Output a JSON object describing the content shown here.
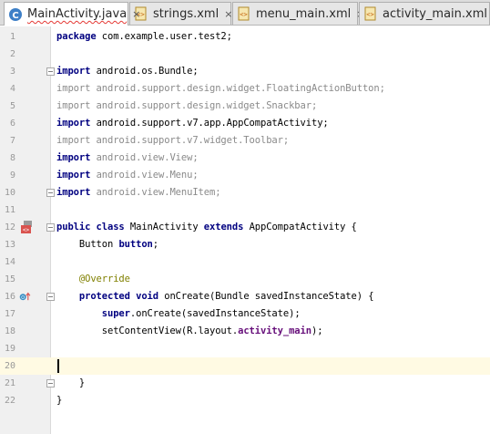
{
  "tabs": [
    {
      "label": "MainActivity.java",
      "icon": "java-class-icon",
      "active": true
    },
    {
      "label": "strings.xml",
      "icon": "xml-file-icon",
      "active": false
    },
    {
      "label": "menu_main.xml",
      "icon": "xml-file-icon",
      "active": false
    },
    {
      "label": "activity_main.xml",
      "icon": "xml-file-icon",
      "active": false
    }
  ],
  "close_glyph": "×",
  "editor": {
    "current_line": 20,
    "lines": [
      {
        "n": "1",
        "tokens": [
          [
            "kw",
            "package"
          ],
          [
            "plain",
            " com.example.user.test2;"
          ]
        ]
      },
      {
        "n": "2",
        "tokens": []
      },
      {
        "n": "3",
        "tokens": [
          [
            "kw",
            "import"
          ],
          [
            "plain",
            " android.os.Bundle;"
          ]
        ]
      },
      {
        "n": "4",
        "tokens": [
          [
            "dim",
            "import android.support.design.widget.FloatingActionButton;"
          ]
        ]
      },
      {
        "n": "5",
        "tokens": [
          [
            "dim",
            "import android.support.design.widget.Snackbar;"
          ]
        ]
      },
      {
        "n": "6",
        "tokens": [
          [
            "kw",
            "import"
          ],
          [
            "plain",
            " android.support.v7.app.AppCompatActivity;"
          ]
        ]
      },
      {
        "n": "7",
        "tokens": [
          [
            "dim",
            "import android.support.v7.widget.Toolbar;"
          ]
        ]
      },
      {
        "n": "8",
        "tokens": [
          [
            "kw",
            "import"
          ],
          [
            "dim",
            " android.view.View;"
          ]
        ]
      },
      {
        "n": "9",
        "tokens": [
          [
            "kw",
            "import"
          ],
          [
            "dim",
            " android.view.Menu;"
          ]
        ]
      },
      {
        "n": "10",
        "tokens": [
          [
            "kw",
            "import"
          ],
          [
            "dim",
            " android.view.MenuItem;"
          ]
        ]
      },
      {
        "n": "11",
        "tokens": []
      },
      {
        "n": "12",
        "tokens": [
          [
            "kw",
            "public class"
          ],
          [
            "plain",
            " MainActivity "
          ],
          [
            "kw",
            "extends"
          ],
          [
            "plain",
            " AppCompatActivity {"
          ]
        ]
      },
      {
        "n": "13",
        "tokens": [
          [
            "plain",
            "    Button "
          ],
          [
            "kw",
            "button"
          ],
          [
            "plain",
            ";"
          ]
        ]
      },
      {
        "n": "14",
        "tokens": []
      },
      {
        "n": "15",
        "tokens": [
          [
            "ann",
            "    @Override"
          ]
        ]
      },
      {
        "n": "16",
        "tokens": [
          [
            "kw",
            "    protected void"
          ],
          [
            "plain",
            " onCreate(Bundle savedInstanceState) {"
          ]
        ]
      },
      {
        "n": "17",
        "tokens": [
          [
            "kw",
            "        super"
          ],
          [
            "plain",
            ".onCreate(savedInstanceState);"
          ]
        ]
      },
      {
        "n": "18",
        "tokens": [
          [
            "plain",
            "        setContentView(R.layout."
          ],
          [
            "field",
            "activity_main"
          ],
          [
            "plain",
            ");"
          ]
        ]
      },
      {
        "n": "19",
        "tokens": []
      },
      {
        "n": "20",
        "tokens": []
      },
      {
        "n": "21",
        "tokens": [
          [
            "plain",
            "    }"
          ]
        ]
      },
      {
        "n": "22",
        "tokens": [
          [
            "plain",
            "}"
          ]
        ]
      }
    ]
  },
  "gutter_markers": [
    {
      "line": "12",
      "icon": "class-gutter-icon",
      "color": "#d9534f"
    },
    {
      "line": "16",
      "icon": "override-method-icon",
      "color": "#3b8fc4"
    }
  ],
  "fold_markers": [
    "3",
    "10",
    "12",
    "16",
    "21"
  ]
}
